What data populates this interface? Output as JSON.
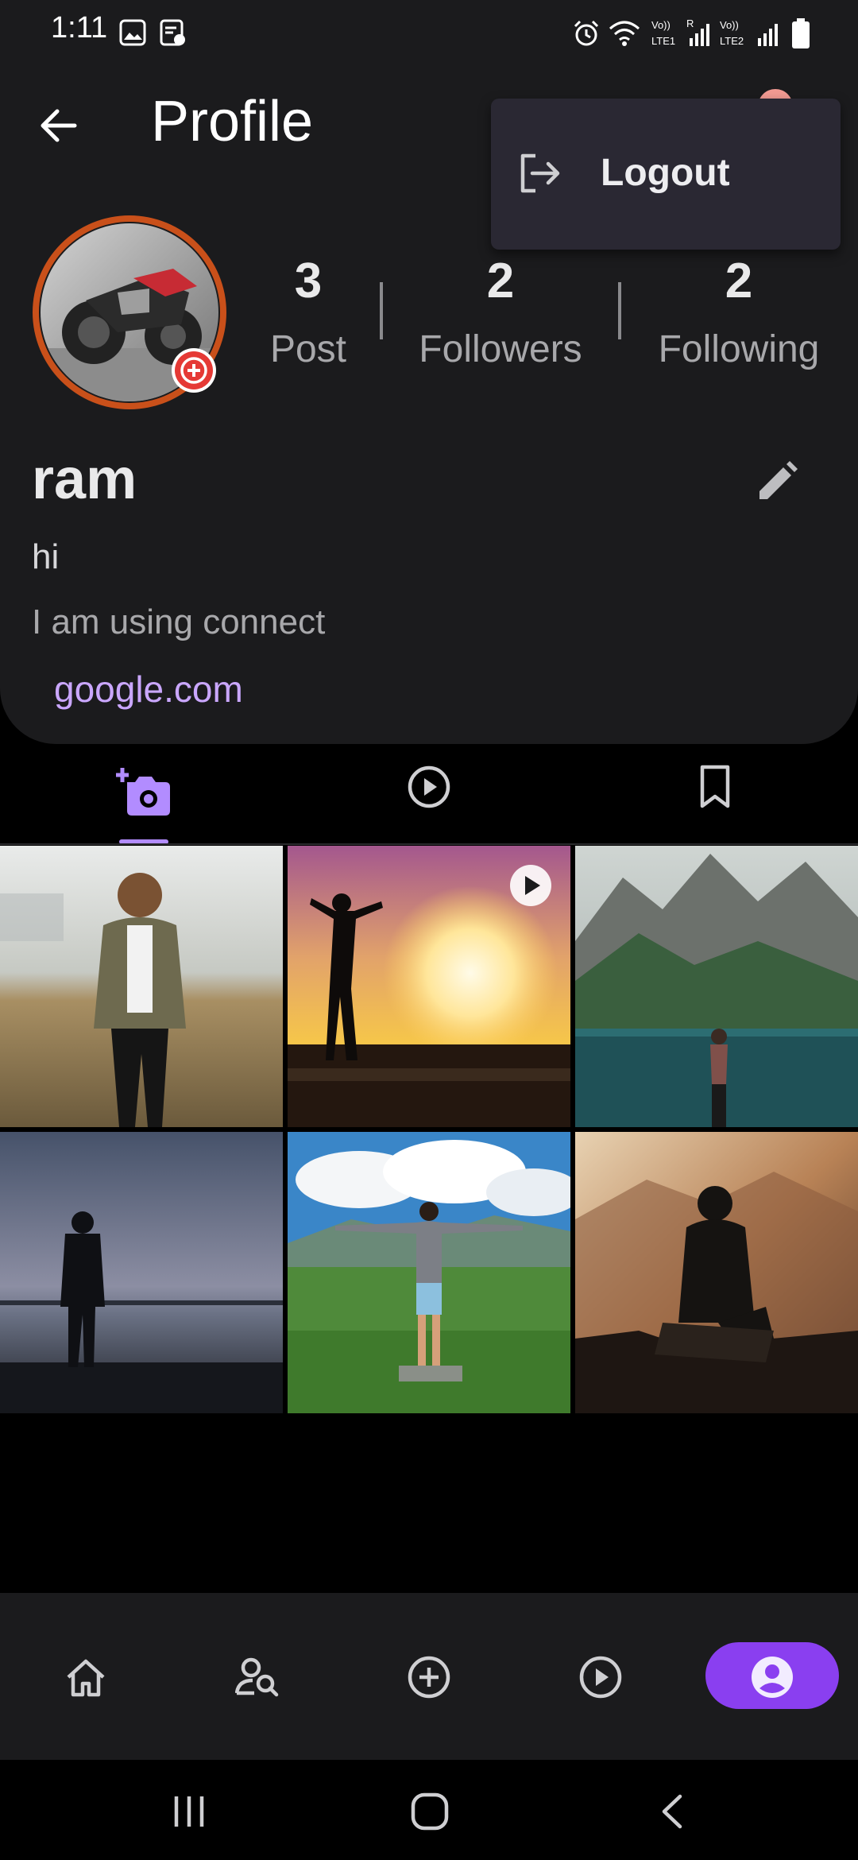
{
  "status_bar": {
    "time": "1:11"
  },
  "header": {
    "title": "Profile"
  },
  "menu": {
    "logout_label": "Logout"
  },
  "stats": [
    {
      "count": "3",
      "label": "Post"
    },
    {
      "count": "2",
      "label": "Followers"
    },
    {
      "count": "2",
      "label": "Following"
    }
  ],
  "profile": {
    "name": "ram",
    "bio_line1": "hi",
    "bio_line2": "I am using connect",
    "website": "google.com"
  },
  "tabs": [
    {
      "icon": "add-photo-icon",
      "active": true
    },
    {
      "icon": "play-circle-icon",
      "active": false
    },
    {
      "icon": "bookmark-icon",
      "active": false
    }
  ],
  "posts": [
    {
      "scene": "woman-field",
      "is_video": false
    },
    {
      "scene": "sunset-silhouette",
      "is_video": true
    },
    {
      "scene": "mountain-lake",
      "is_video": false
    },
    {
      "scene": "dusk-lake",
      "is_video": false
    },
    {
      "scene": "green-valley",
      "is_video": false
    },
    {
      "scene": "hill-sunrise",
      "is_video": false
    }
  ],
  "bottom_nav": [
    {
      "icon": "home-icon",
      "active": false
    },
    {
      "icon": "search-user-icon",
      "active": false
    },
    {
      "icon": "add-circle-icon",
      "active": false
    },
    {
      "icon": "play-circle-icon",
      "active": false
    },
    {
      "icon": "profile-icon",
      "active": true
    }
  ],
  "colors": {
    "accent": "#8a3ff0",
    "link": "#caa7ff",
    "avatar_ring": "#c9501a",
    "badge": "#e53935"
  }
}
